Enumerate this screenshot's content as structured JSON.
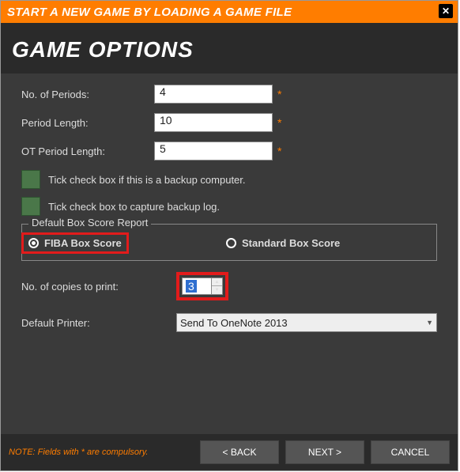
{
  "titlebar": {
    "title": "START A NEW GAME BY LOADING A GAME FILE"
  },
  "header": {
    "title": "GAME OPTIONS"
  },
  "form": {
    "periods_label": "No. of Periods:",
    "periods_value": "4",
    "period_length_label": "Period Length:",
    "period_length_value": "10",
    "ot_length_label": "OT Period Length:",
    "ot_length_value": "5",
    "asterisk": "*",
    "backup_checkbox_label": "Tick check box if this is a backup computer.",
    "capture_log_checkbox_label": "Tick check box to capture backup log.",
    "box_score_legend": "Default Box Score Report",
    "radio_fiba_label": "FIBA Box Score",
    "radio_standard_label": "Standard Box Score",
    "copies_label": "No. of copies to print:",
    "copies_value": "3",
    "default_printer_label": "Default Printer:",
    "default_printer_value": "Send To OneNote 2013"
  },
  "footer": {
    "note": "NOTE: Fields with * are compulsory.",
    "back_label": "<  BACK",
    "next_label": "NEXT  >",
    "cancel_label": "CANCEL"
  }
}
